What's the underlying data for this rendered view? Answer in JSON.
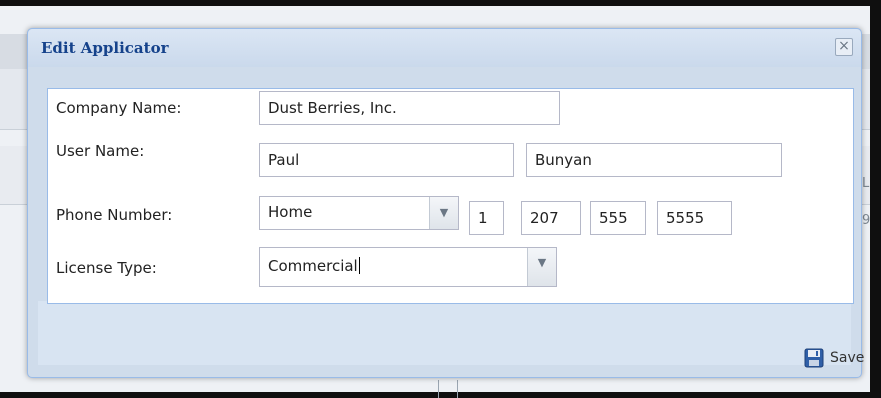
{
  "dialog": {
    "title": "Edit Applicator",
    "close_glyph": "×",
    "close_icon": "close-icon"
  },
  "form": {
    "company_label": "Company Name:",
    "company_value": "Dust Berries, Inc.",
    "user_label": "User Name:",
    "first_name": "Paul",
    "last_name": "Bunyan",
    "phone_label": "Phone Number:",
    "phone_type": "Home",
    "phone_country": "1",
    "phone_area": "207",
    "phone_prefix": "555",
    "phone_line": "5555",
    "license_label": "License Type:",
    "license_value": "Commercial"
  },
  "footer": {
    "save_label": "Save",
    "save_icon": "floppy-disk-icon"
  },
  "background": {
    "fragment_1": "L",
    "fragment_2": "9"
  },
  "colors": {
    "title": "#15428b",
    "border": "#99bbe8",
    "dialog_bg": "#cfdceb"
  }
}
